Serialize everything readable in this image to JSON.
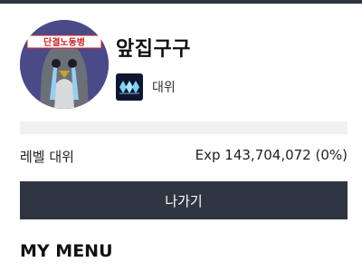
{
  "profile": {
    "username": "앞집구구",
    "avatar_caption": "단결노동병",
    "rank": {
      "label": "대위",
      "icon": "diamond-rank-icon"
    }
  },
  "level": {
    "label": "레벨 대위",
    "exp_text": "Exp 143,704,072 (0%)",
    "progress_percent": 0
  },
  "actions": {
    "leave_label": "나가기"
  },
  "menu": {
    "title": "MY MENU"
  },
  "colors": {
    "header_bar": "#2f3641",
    "button_bg": "#2f3641",
    "exp_track": "#eef0f3",
    "avatar_bg": "#4a4a88",
    "rank_icon_bg": "#0f1730",
    "rank_diamond": "#7fd3f5"
  }
}
